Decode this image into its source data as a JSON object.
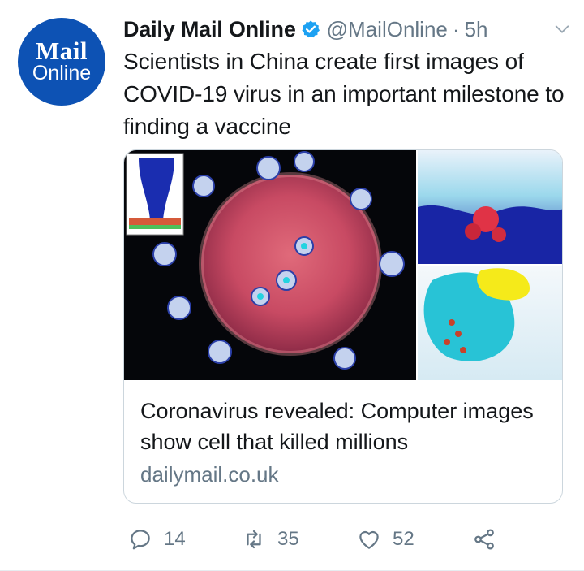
{
  "avatar": {
    "brand_top": "Mail",
    "brand_bottom": "Online",
    "color": "#0d52b4"
  },
  "tweet": {
    "display_name": "Daily Mail Online",
    "handle": "@MailOnline",
    "separator": "·",
    "time": "5h",
    "verified_color": "#1da1f2",
    "text": "Scientists in China create first images of COVID-19 virus in an important milestone to finding a vaccine"
  },
  "card": {
    "title": "Coronavirus revealed: Computer images show cell that killed millions",
    "domain": "dailymail.co.uk"
  },
  "actions": {
    "reply_count": "14",
    "retweet_count": "35",
    "like_count": "52"
  },
  "icons": {
    "verified": "verified-badge-icon",
    "more": "chevron-down-icon",
    "reply": "reply-icon",
    "retweet": "retweet-icon",
    "like": "heart-icon",
    "share": "share-icon"
  }
}
